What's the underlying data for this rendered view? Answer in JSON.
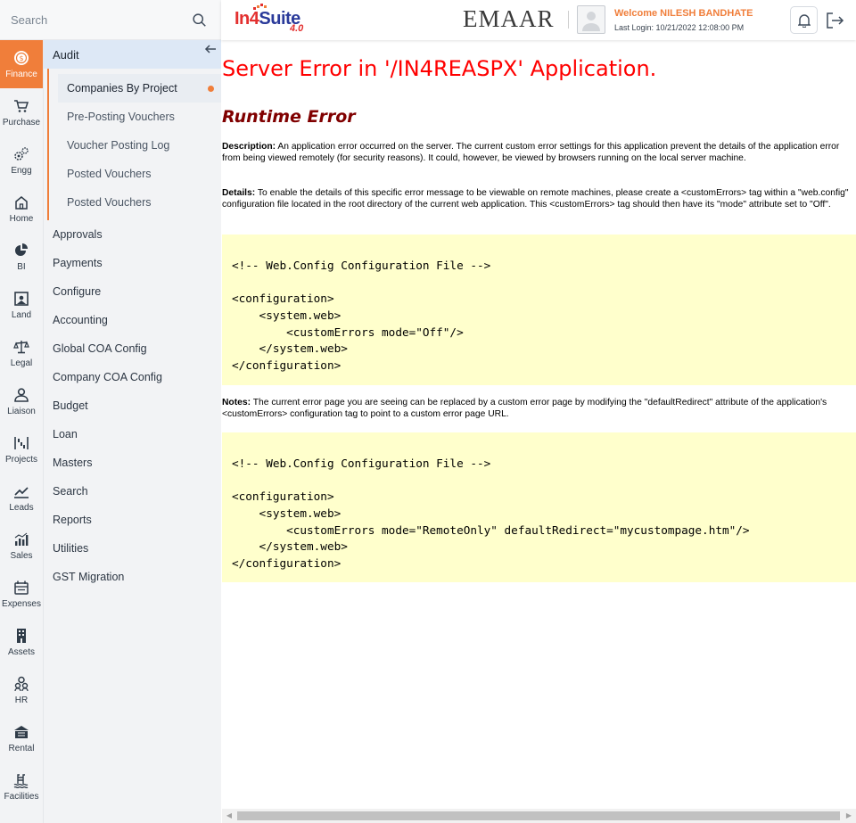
{
  "search": {
    "placeholder": "Search"
  },
  "rail": [
    {
      "label": "Finance",
      "icon": "dollar-coin-icon",
      "active": true
    },
    {
      "label": "Purchase",
      "icon": "cart-icon"
    },
    {
      "label": "Engg",
      "icon": "gears-icon"
    },
    {
      "label": "Home",
      "icon": "home-icon"
    },
    {
      "label": "BI",
      "icon": "pie-chart-icon"
    },
    {
      "label": "Land",
      "icon": "land-icon"
    },
    {
      "label": "Legal",
      "icon": "scales-icon"
    },
    {
      "label": "Liaison",
      "icon": "person-icon"
    },
    {
      "label": "Projects",
      "icon": "projects-icon"
    },
    {
      "label": "Leads",
      "icon": "trend-icon"
    },
    {
      "label": "Sales",
      "icon": "bar-chart-icon"
    },
    {
      "label": "Expenses",
      "icon": "expenses-icon"
    },
    {
      "label": "Assets",
      "icon": "building-icon"
    },
    {
      "label": "HR",
      "icon": "people-icon"
    },
    {
      "label": "Rental",
      "icon": "rental-icon"
    },
    {
      "label": "Facilities",
      "icon": "pool-icon"
    }
  ],
  "submenu": {
    "header": "Audit",
    "children": [
      "Companies By Project",
      "Pre-Posting Vouchers",
      "Voucher Posting Log",
      "Posted Vouchers",
      "Posted Vouchers"
    ],
    "items": [
      "Approvals",
      "Payments",
      "Configure",
      "Accounting",
      "Global COA Config",
      "Company COA Config",
      "Budget",
      "Loan",
      "Masters",
      "Search",
      "Reports",
      "Utilities",
      "GST Migration"
    ]
  },
  "header": {
    "logo_in": "In",
    "logo_four": "4",
    "logo_suite": "Suite",
    "logo_version": "4.0",
    "brand": "EMAAR",
    "welcome": "Welcome NILESH BANDHATE",
    "last_login": "Last Login: 10/21/2022 12:08:00 PM"
  },
  "page": {
    "title": "Server Error in '/IN4REASPX' Application.",
    "subtitle": "Runtime Error",
    "description_label": "Description:",
    "description_text": " An application error occurred on the server. The current custom error settings for this application prevent the details of the application error from being viewed remotely (for security reasons). It could, however, be viewed by browsers running on the local server machine.",
    "details_label": "Details:",
    "details_text": " To enable the details of this specific error message to be viewable on remote machines, please create a <customErrors> tag within a \"web.config\" configuration file located in the root directory of the current web application. This <customErrors> tag should then have its \"mode\" attribute set to \"Off\".",
    "code1": "\n<!-- Web.Config Configuration File -->\n\n<configuration>\n    <system.web>\n        <customErrors mode=\"Off\"/>\n    </system.web>\n</configuration>\n",
    "notes_label": "Notes:",
    "notes_text": " The current error page you are seeing can be replaced by a custom error page by modifying the \"defaultRedirect\" attribute of the application's <customErrors> configuration tag to point to a custom error page URL.",
    "code2": "\n<!-- Web.Config Configuration File -->\n\n<configuration>\n    <system.web>\n        <customErrors mode=\"RemoteOnly\" defaultRedirect=\"mycustompage.htm\"/>\n    </system.web>\n</configuration>\n"
  },
  "colors": {
    "accent": "#f07e3a",
    "error_title": "#ff0000",
    "runtime": "#800000",
    "code_bg": "#ffffcc"
  }
}
